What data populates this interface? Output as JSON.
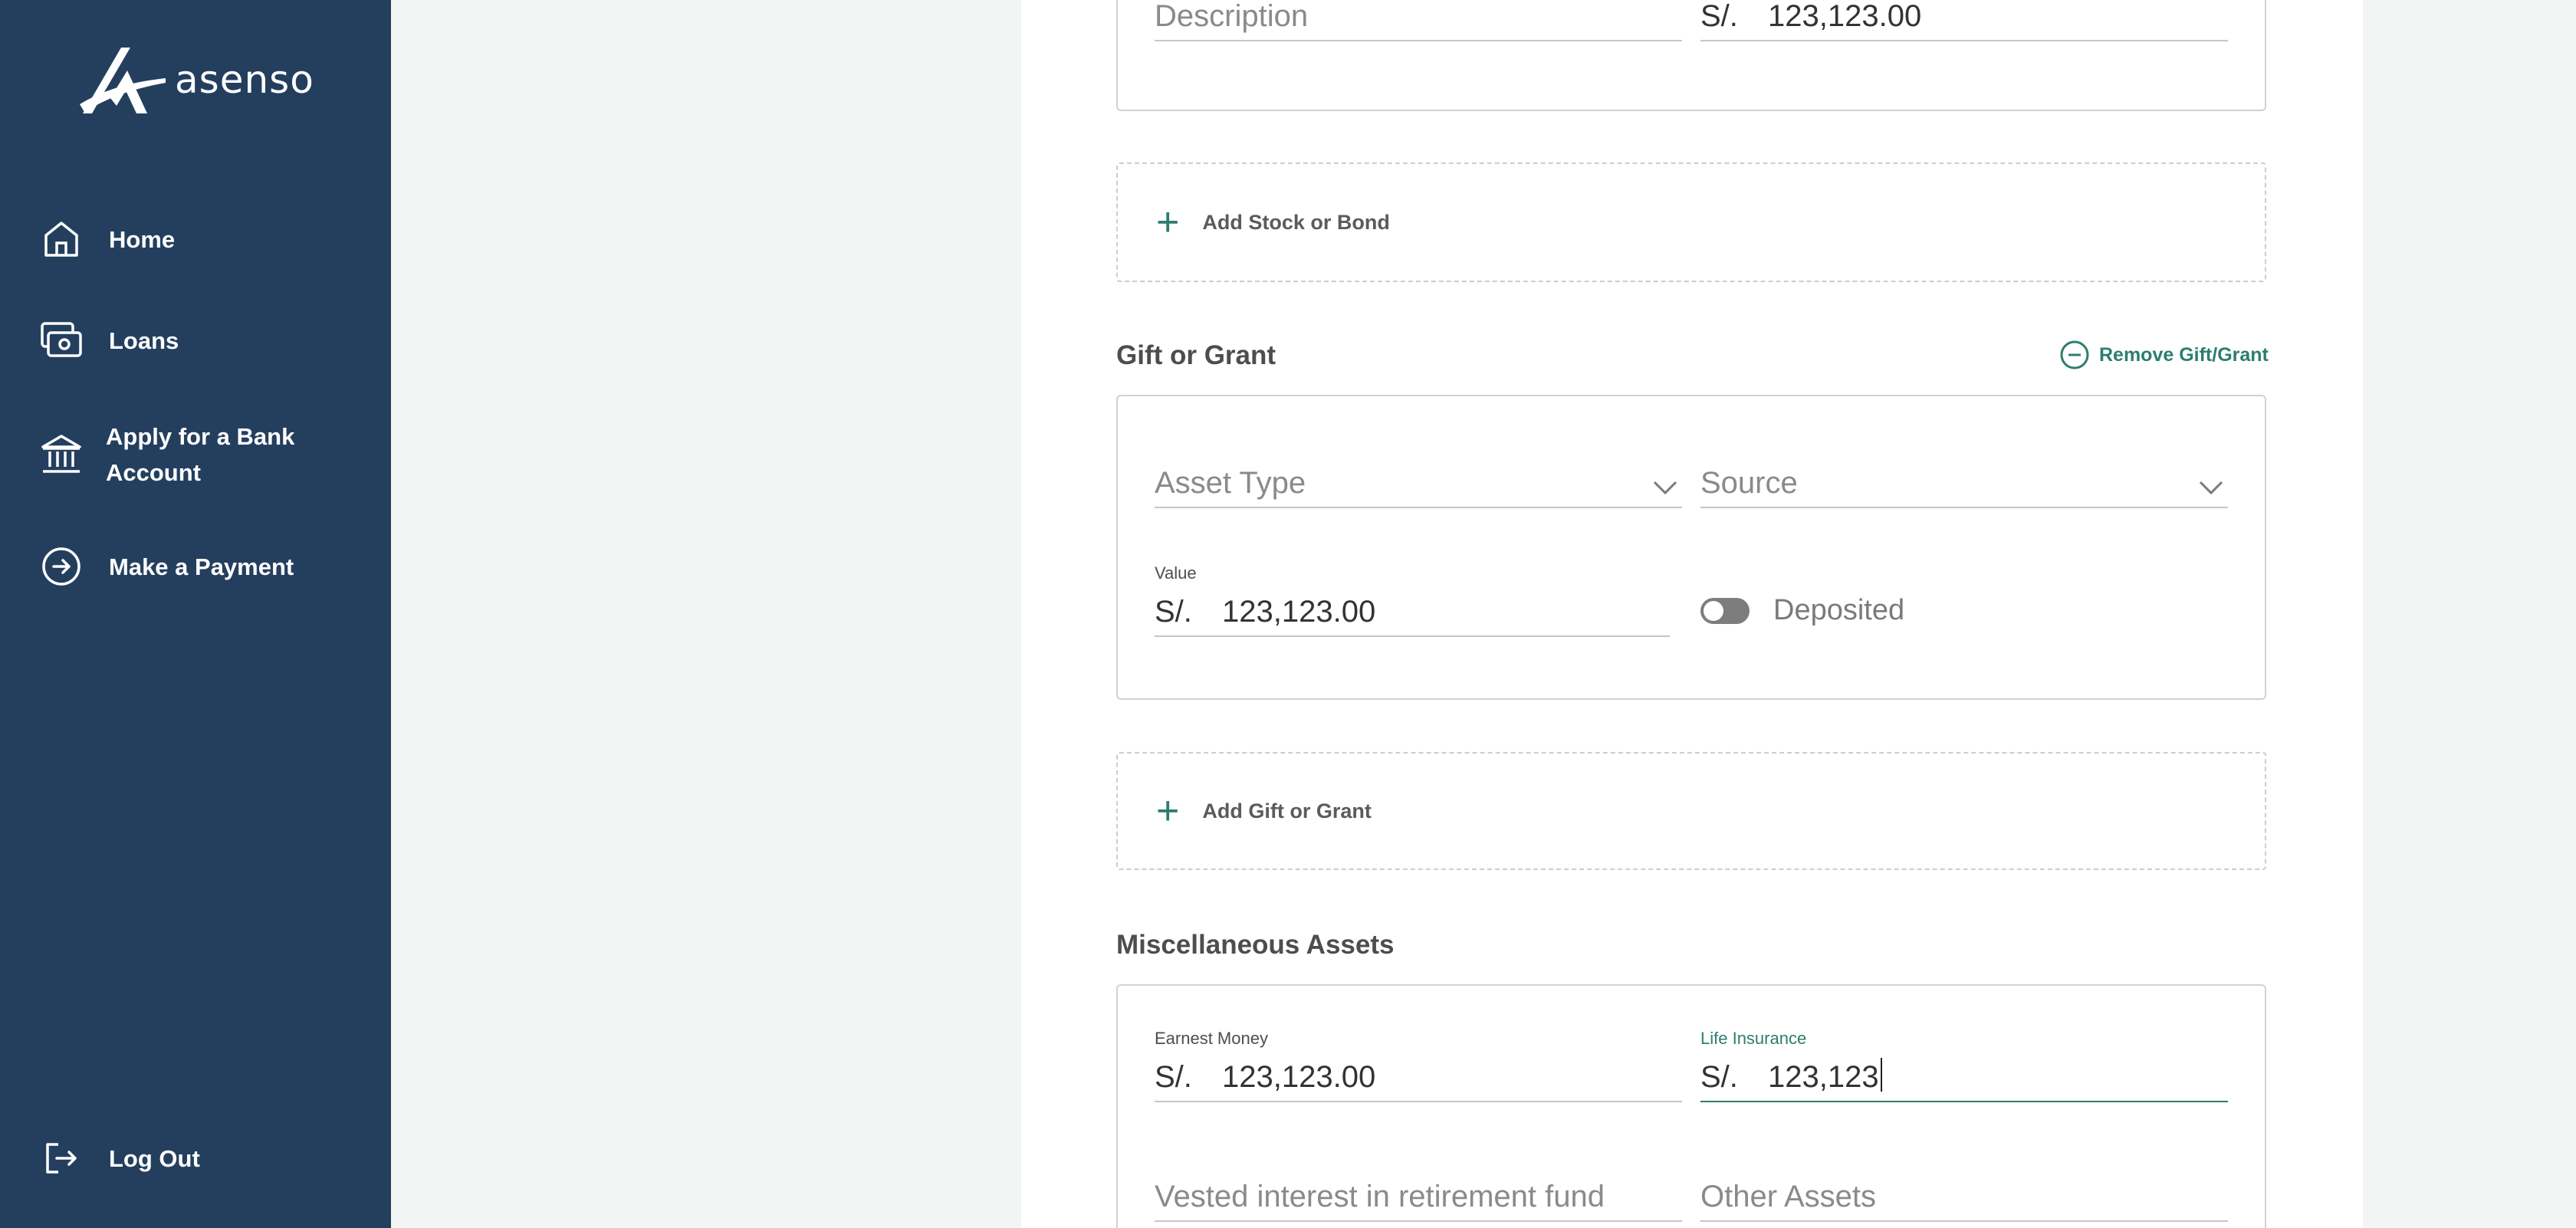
{
  "brand": {
    "name": "asenso"
  },
  "sidebar": {
    "items": [
      {
        "label": "Home",
        "icon": "home-icon"
      },
      {
        "label": "Loans",
        "icon": "money-icon"
      },
      {
        "label": "Apply for a Bank Account",
        "icon": "bank-icon"
      },
      {
        "label": "Make a Payment",
        "icon": "arrow-circle-icon"
      }
    ],
    "logout": {
      "label": "Log Out",
      "icon": "logout-icon"
    }
  },
  "top_card": {
    "description_placeholder": "Description",
    "currency": "S/.",
    "amount": "123,123.00"
  },
  "add_stock": {
    "label": "Add Stock or Bond"
  },
  "gift": {
    "title": "Gift or Grant",
    "remove_label": "Remove Gift/Grant",
    "asset_type_placeholder": "Asset Type",
    "source_placeholder": "Source",
    "value_label": "Value",
    "currency": "S/.",
    "value": "123,123.00",
    "deposited_label": "Deposited",
    "deposited": false
  },
  "add_gift": {
    "label": "Add Gift or Grant"
  },
  "misc": {
    "title": "Miscellaneous Assets",
    "earnest_label": "Earnest Money",
    "earnest_currency": "S/.",
    "earnest_value": "123,123.00",
    "life_label": "Life Insurance",
    "life_currency": "S/.",
    "life_value": "123,123",
    "vested_placeholder": "Vested interest in retirement fund",
    "other_placeholder": "Other Assets"
  },
  "colors": {
    "sidebar": "#243f5e",
    "accent": "#2e7d6e"
  }
}
